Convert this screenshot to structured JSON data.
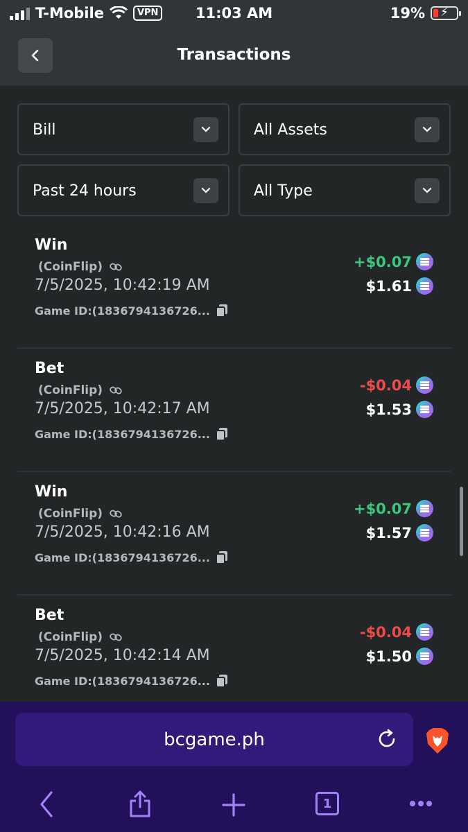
{
  "status_bar": {
    "carrier": "T-Mobile",
    "vpn": "VPN",
    "time": "11:03 AM",
    "battery": "19%"
  },
  "header": {
    "title": "Transactions"
  },
  "filters": {
    "category": "Bill",
    "assets": "All Assets",
    "period": "Past 24 hours",
    "type": "All Type"
  },
  "transactions": [
    {
      "type": "Win",
      "game": "(CoinFlip)",
      "date": "7/5/2025, 10:42:19 AM",
      "game_id": "Game ID:(1836794136726...",
      "amount": "+$0.07",
      "balance": "$1.61"
    },
    {
      "type": "Bet",
      "game": "(CoinFlip)",
      "date": "7/5/2025, 10:42:17 AM",
      "game_id": "Game ID:(1836794136726...",
      "amount": "-$0.04",
      "balance": "$1.53"
    },
    {
      "type": "Win",
      "game": "(CoinFlip)",
      "date": "7/5/2025, 10:42:16 AM",
      "game_id": "Game ID:(1836794136726...",
      "amount": "+$0.07",
      "balance": "$1.57"
    },
    {
      "type": "Bet",
      "game": "(CoinFlip)",
      "date": "7/5/2025, 10:42:14 AM",
      "game_id": "Game ID:(1836794136726...",
      "amount": "-$0.04",
      "balance": "$1.50"
    }
  ],
  "browser": {
    "url": "bcgame.ph",
    "tab_count": "1"
  },
  "colors": {
    "positive": "#3bc77e",
    "negative": "#ed4b4b",
    "browser_bg": "#23105a"
  }
}
